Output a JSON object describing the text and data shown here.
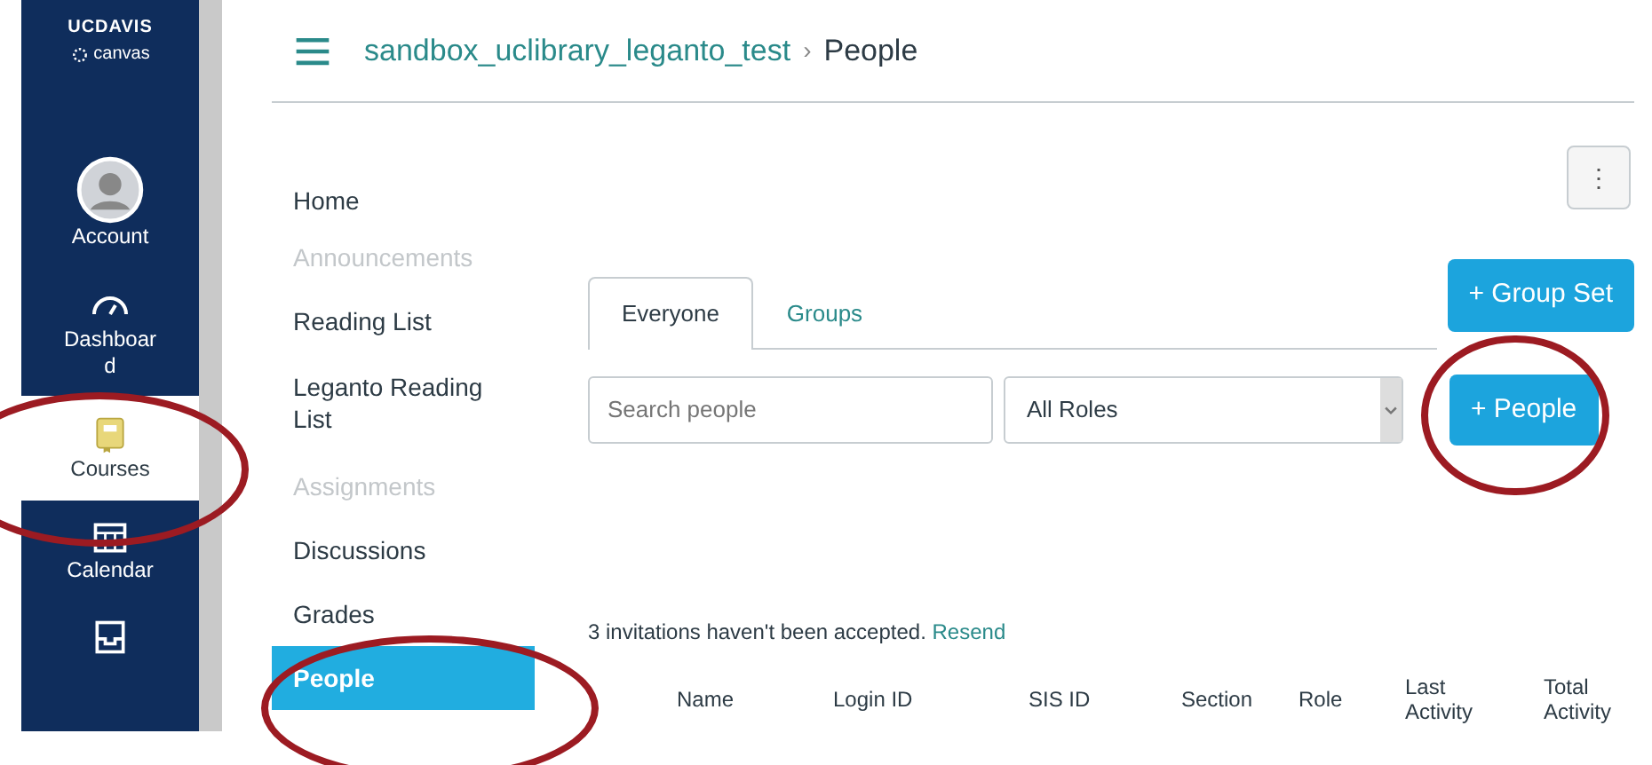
{
  "global_nav": {
    "logo": {
      "line_1": "UCDAVIS",
      "line_2": "canvas"
    },
    "items": [
      {
        "kind": "avatar",
        "label": "Account",
        "selected": false,
        "circled": false
      },
      {
        "kind": "dashboard",
        "label": "Dashboard",
        "selected": false,
        "circled": false
      },
      {
        "kind": "courses",
        "label": "Courses",
        "selected": true,
        "circled": true
      },
      {
        "kind": "calendar",
        "label": "Calendar",
        "selected": false,
        "circled": false
      },
      {
        "kind": "inbox",
        "selected": false,
        "circled": false
      }
    ]
  },
  "breadcrumb": {
    "course": "sandbox_uclibrary_leganto_test",
    "separator": "›",
    "page": "People"
  },
  "course_nav": [
    {
      "label": "Home",
      "disabled": false,
      "selected": false,
      "circled": false
    },
    {
      "label": "Announcements",
      "disabled": true,
      "selected": false,
      "circled": false
    },
    {
      "label": "Reading List",
      "disabled": false,
      "selected": false,
      "circled": false
    },
    {
      "label": "Leganto Reading List",
      "disabled": false,
      "selected": false,
      "circled": false
    },
    {
      "label": "Assignments",
      "disabled": true,
      "selected": false,
      "circled": false
    },
    {
      "label": "Discussions",
      "disabled": false,
      "selected": false,
      "circled": false
    },
    {
      "label": "Grades",
      "disabled": false,
      "selected": false,
      "circled": false
    },
    {
      "label": "People",
      "disabled": false,
      "selected": true,
      "circled": true
    }
  ],
  "tabs": [
    {
      "label": "Everyone",
      "selected": true
    },
    {
      "label": "Groups",
      "selected": false
    }
  ],
  "more_button": {
    "label": "⋮"
  },
  "group_set_button": {
    "icon": "+",
    "label": "Group Set"
  },
  "search": {
    "placeholder": "Search people"
  },
  "role_select": {
    "value": "All Roles"
  },
  "people_button": {
    "icon": "+",
    "label": "People",
    "circled": true
  },
  "invitations": {
    "text": "3 invitations haven't been accepted.",
    "link": "Resend"
  },
  "table": {
    "columns": [
      "Name",
      "Login ID",
      "SIS ID",
      "Section",
      "Role",
      "Last Activity",
      "Total Activity"
    ]
  }
}
